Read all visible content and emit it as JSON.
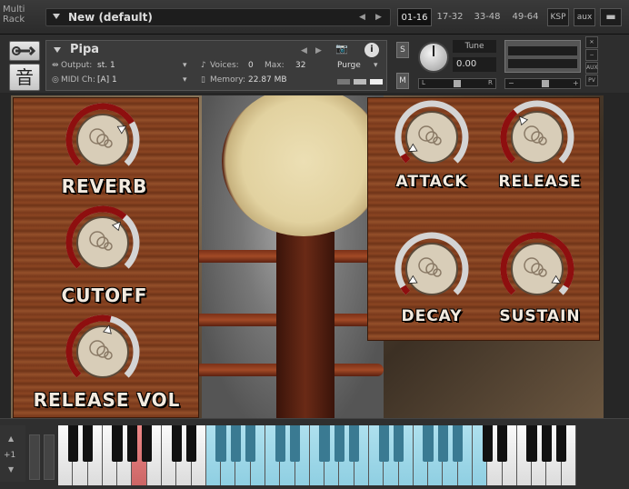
{
  "rack": {
    "label_line1": "Multi",
    "label_line2": "Rack",
    "preset": "New (default)",
    "tabs": [
      "01-16",
      "17-32",
      "33-48",
      "49-64"
    ],
    "active_tab": "01-16",
    "ksp": "KSP",
    "aux": "aux"
  },
  "instrument": {
    "name": "Pipa",
    "output_label": "Output:",
    "output_value": "st. 1",
    "midi_label": "MIDI Ch:",
    "midi_value": "[A]  1",
    "voices_label": "Voices:",
    "voices_value": "0",
    "max_label": "Max:",
    "max_value": "32",
    "memory_label": "Memory:",
    "memory_value": "22.87 MB",
    "purge_label": "Purge",
    "logo_glyph": "音",
    "s_label": "S",
    "m_label": "M",
    "tune_label": "Tune",
    "tune_value": "0.00",
    "pan_l": "L",
    "pan_r": "R",
    "aux_label": "AUX",
    "pv_label": "PV"
  },
  "controls": {
    "left": [
      {
        "label": "REVERB",
        "value": 0.72
      },
      {
        "label": "CUTOFF",
        "value": 0.65
      },
      {
        "label": "RELEASE VOL",
        "value": 0.55
      }
    ],
    "right": [
      {
        "label": "ATTACK",
        "value": 0.05
      },
      {
        "label": "RELEASE",
        "value": 0.35
      },
      {
        "label": "DECAY",
        "value": 0.05
      },
      {
        "label": "SUSTAIN",
        "value": 0.95
      }
    ]
  },
  "keyboard": {
    "octave_shift": "+1"
  },
  "colors": {
    "knob_arc": "#8e0f0f",
    "knob_track": "#d4d4d4",
    "key_highlight": "#8fcfe2",
    "key_pressed": "#d06060"
  }
}
